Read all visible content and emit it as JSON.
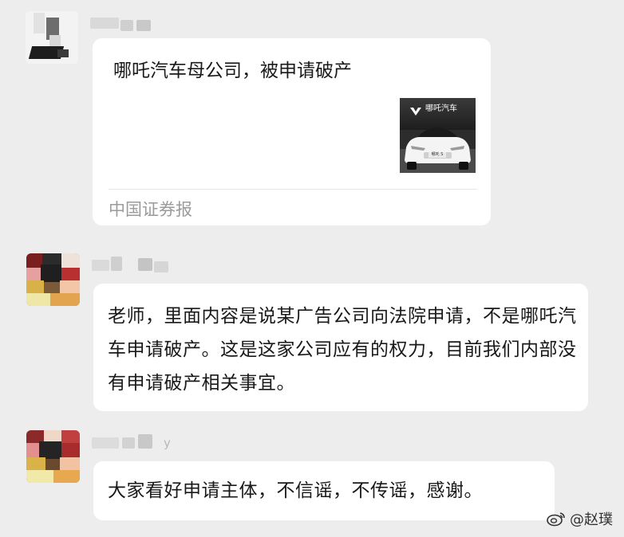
{
  "chat": {
    "link_card": {
      "title": "哪吒汽车母公司，被申请破产",
      "thumbnail": {
        "brand": "哪吒汽车",
        "plate": "哪吒 S"
      },
      "source": "中国证券报"
    },
    "messages": [
      {
        "text": "老师，里面内容是说某广告公司向法院申请，不是哪吒汽车申请破产。这是这家公司应有的权力，目前我们内部没有申请破产相关事宜。"
      },
      {
        "text": "大家看好申请主体，不信谣，不传谣，感谢。"
      }
    ],
    "sender_name_suffix": "y"
  },
  "watermark": {
    "icon": "weibo-icon",
    "text": "@赵璞"
  },
  "colors": {
    "background": "#ededed",
    "bubble": "#ffffff",
    "source_text": "#9b9b9b"
  }
}
